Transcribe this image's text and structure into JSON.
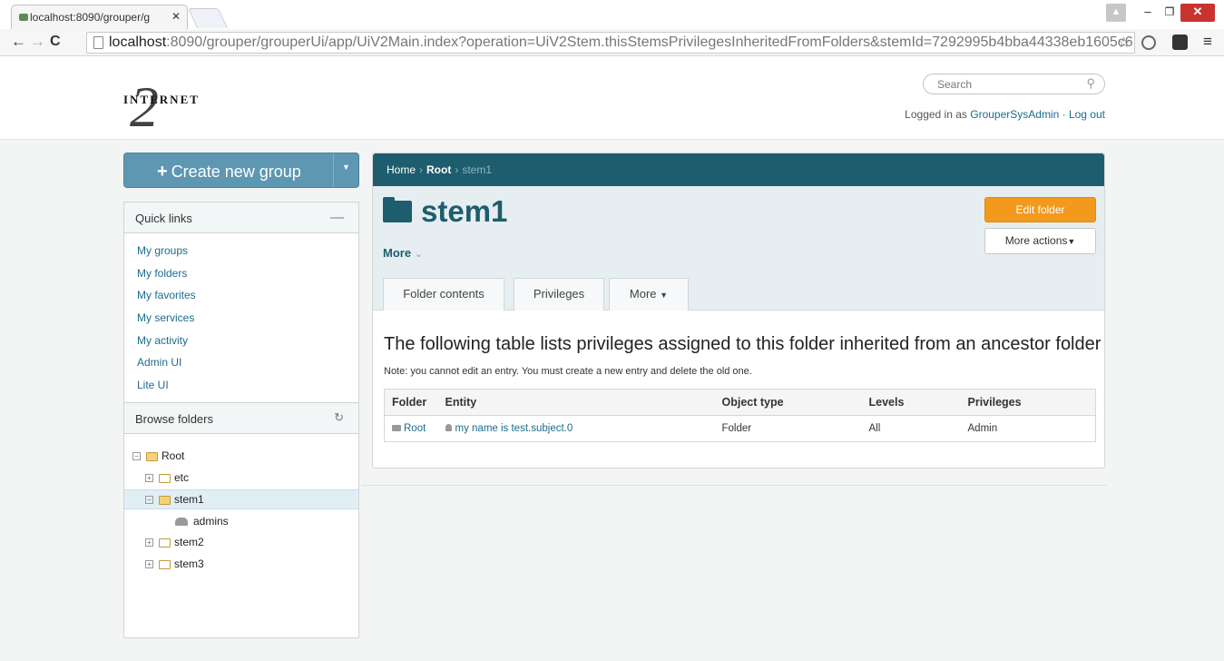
{
  "browser": {
    "tab_title": "localhost:8090/grouper/g",
    "url_host": "localhost",
    "url_rest": ":8090/grouper/grouperUi/app/UiV2Main.index?operation=UiV2Stem.thisStemsPrivilegesInheritedFromFolders&stemId=7292995b4bba44338eb1605c6"
  },
  "header": {
    "logo_text": "INTERNET",
    "logo_numeral": "2",
    "search_placeholder": "Search",
    "logged_in_prefix": "Logged in as ",
    "user_name": "GrouperSysAdmin",
    "separator": " · ",
    "logout": "Log out"
  },
  "sidebar": {
    "create_label": "Create new group",
    "quick_links_title": "Quick links",
    "quick_links": [
      "My groups",
      "My folders",
      "My favorites",
      "My services",
      "My activity",
      "Admin UI",
      "Lite UI"
    ],
    "browse_title": "Browse folders",
    "tree": [
      "Root",
      "etc",
      "stem1",
      "admins",
      "stem2",
      "stem3"
    ]
  },
  "main": {
    "breadcrumb": [
      "Home",
      "Root",
      "stem1"
    ],
    "title": "stem1",
    "more_label": "More",
    "edit_folder": "Edit folder",
    "more_actions": "More actions",
    "tabs": [
      "Folder contents",
      "Privileges",
      "More"
    ],
    "description": "The following table lists privileges assigned to this folder inherited from an ancestor folder",
    "note": "Note: you cannot edit an entry. You must create a new entry and delete the old one.",
    "table": {
      "headers": [
        "Folder",
        "Entity",
        "Object type",
        "Levels",
        "Privileges"
      ],
      "rows": [
        {
          "folder": "Root",
          "entity": "my name is test.subject.0",
          "object_type": "Folder",
          "levels": "All",
          "privileges": "Admin"
        }
      ]
    }
  },
  "colors": {
    "accent": "#1e5d6d",
    "edit_button": "#f39a1d",
    "link": "#1b6c8c"
  }
}
